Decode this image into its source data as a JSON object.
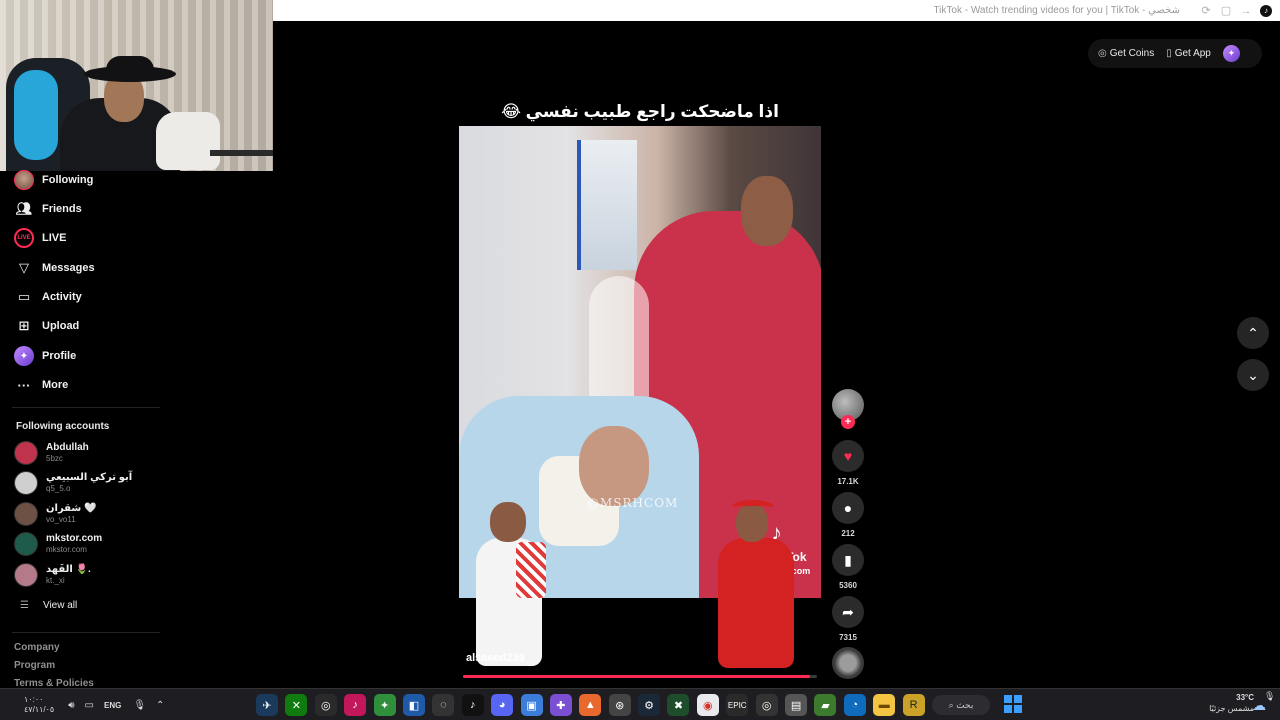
{
  "browser": {
    "tab_title": "TikTok - Watch trending videos for you | TikTok - شخصي"
  },
  "sidebar": {
    "items": [
      {
        "label": "Following",
        "icon": "following-avatar-icon"
      },
      {
        "label": "Friends",
        "icon": "friends-icon"
      },
      {
        "label": "LIVE",
        "icon": "live-icon"
      },
      {
        "label": "Messages",
        "icon": "send-icon"
      },
      {
        "label": "Activity",
        "icon": "activity-icon"
      },
      {
        "label": "Upload",
        "icon": "upload-icon"
      },
      {
        "label": "Profile",
        "icon": "profile-icon"
      },
      {
        "label": "More",
        "icon": "more-icon"
      }
    ],
    "following_title": "Following accounts",
    "accounts": [
      {
        "name": "Abdullah",
        "handle": "5bzc",
        "color": "#c0334c"
      },
      {
        "name": "آبو تركي السبيعي",
        "handle": "q5_5.o",
        "color": "#cfcfcf"
      },
      {
        "name": "شقران 🤍",
        "handle": "vo_vo11",
        "color": "#6e5145"
      },
      {
        "name": "mkstor.com",
        "handle": "mkstor.com",
        "color": "#1f5b4a"
      },
      {
        "name": "الفَهد 🌷.",
        "handle": "kt._xi",
        "color": "#b47a8a"
      }
    ],
    "view_all": "View all",
    "footer": [
      "Company",
      "Program",
      "Terms & Policies"
    ]
  },
  "top_actions": {
    "get_coins": "Get Coins",
    "get_app": "Get App"
  },
  "video": {
    "caption": "اذا ماضحكت راجع طبيب نفسي 😂",
    "watermark": "@MSRHCOM",
    "brand": "TikTok",
    "brand_user": "@msrhcom",
    "author": "alsaeed239",
    "progress": 0.98,
    "likes": "17.1K",
    "comments": "212",
    "saves": "5360",
    "shares": "7315"
  },
  "taskbar": {
    "time": "١٠:٠٠",
    "date": "٤٧/١١/٠٥",
    "lang": "ENG",
    "search": "بحث",
    "temp": "33°C",
    "weather": "مشمس جزئيًا",
    "accent": "#3aa0ff"
  }
}
